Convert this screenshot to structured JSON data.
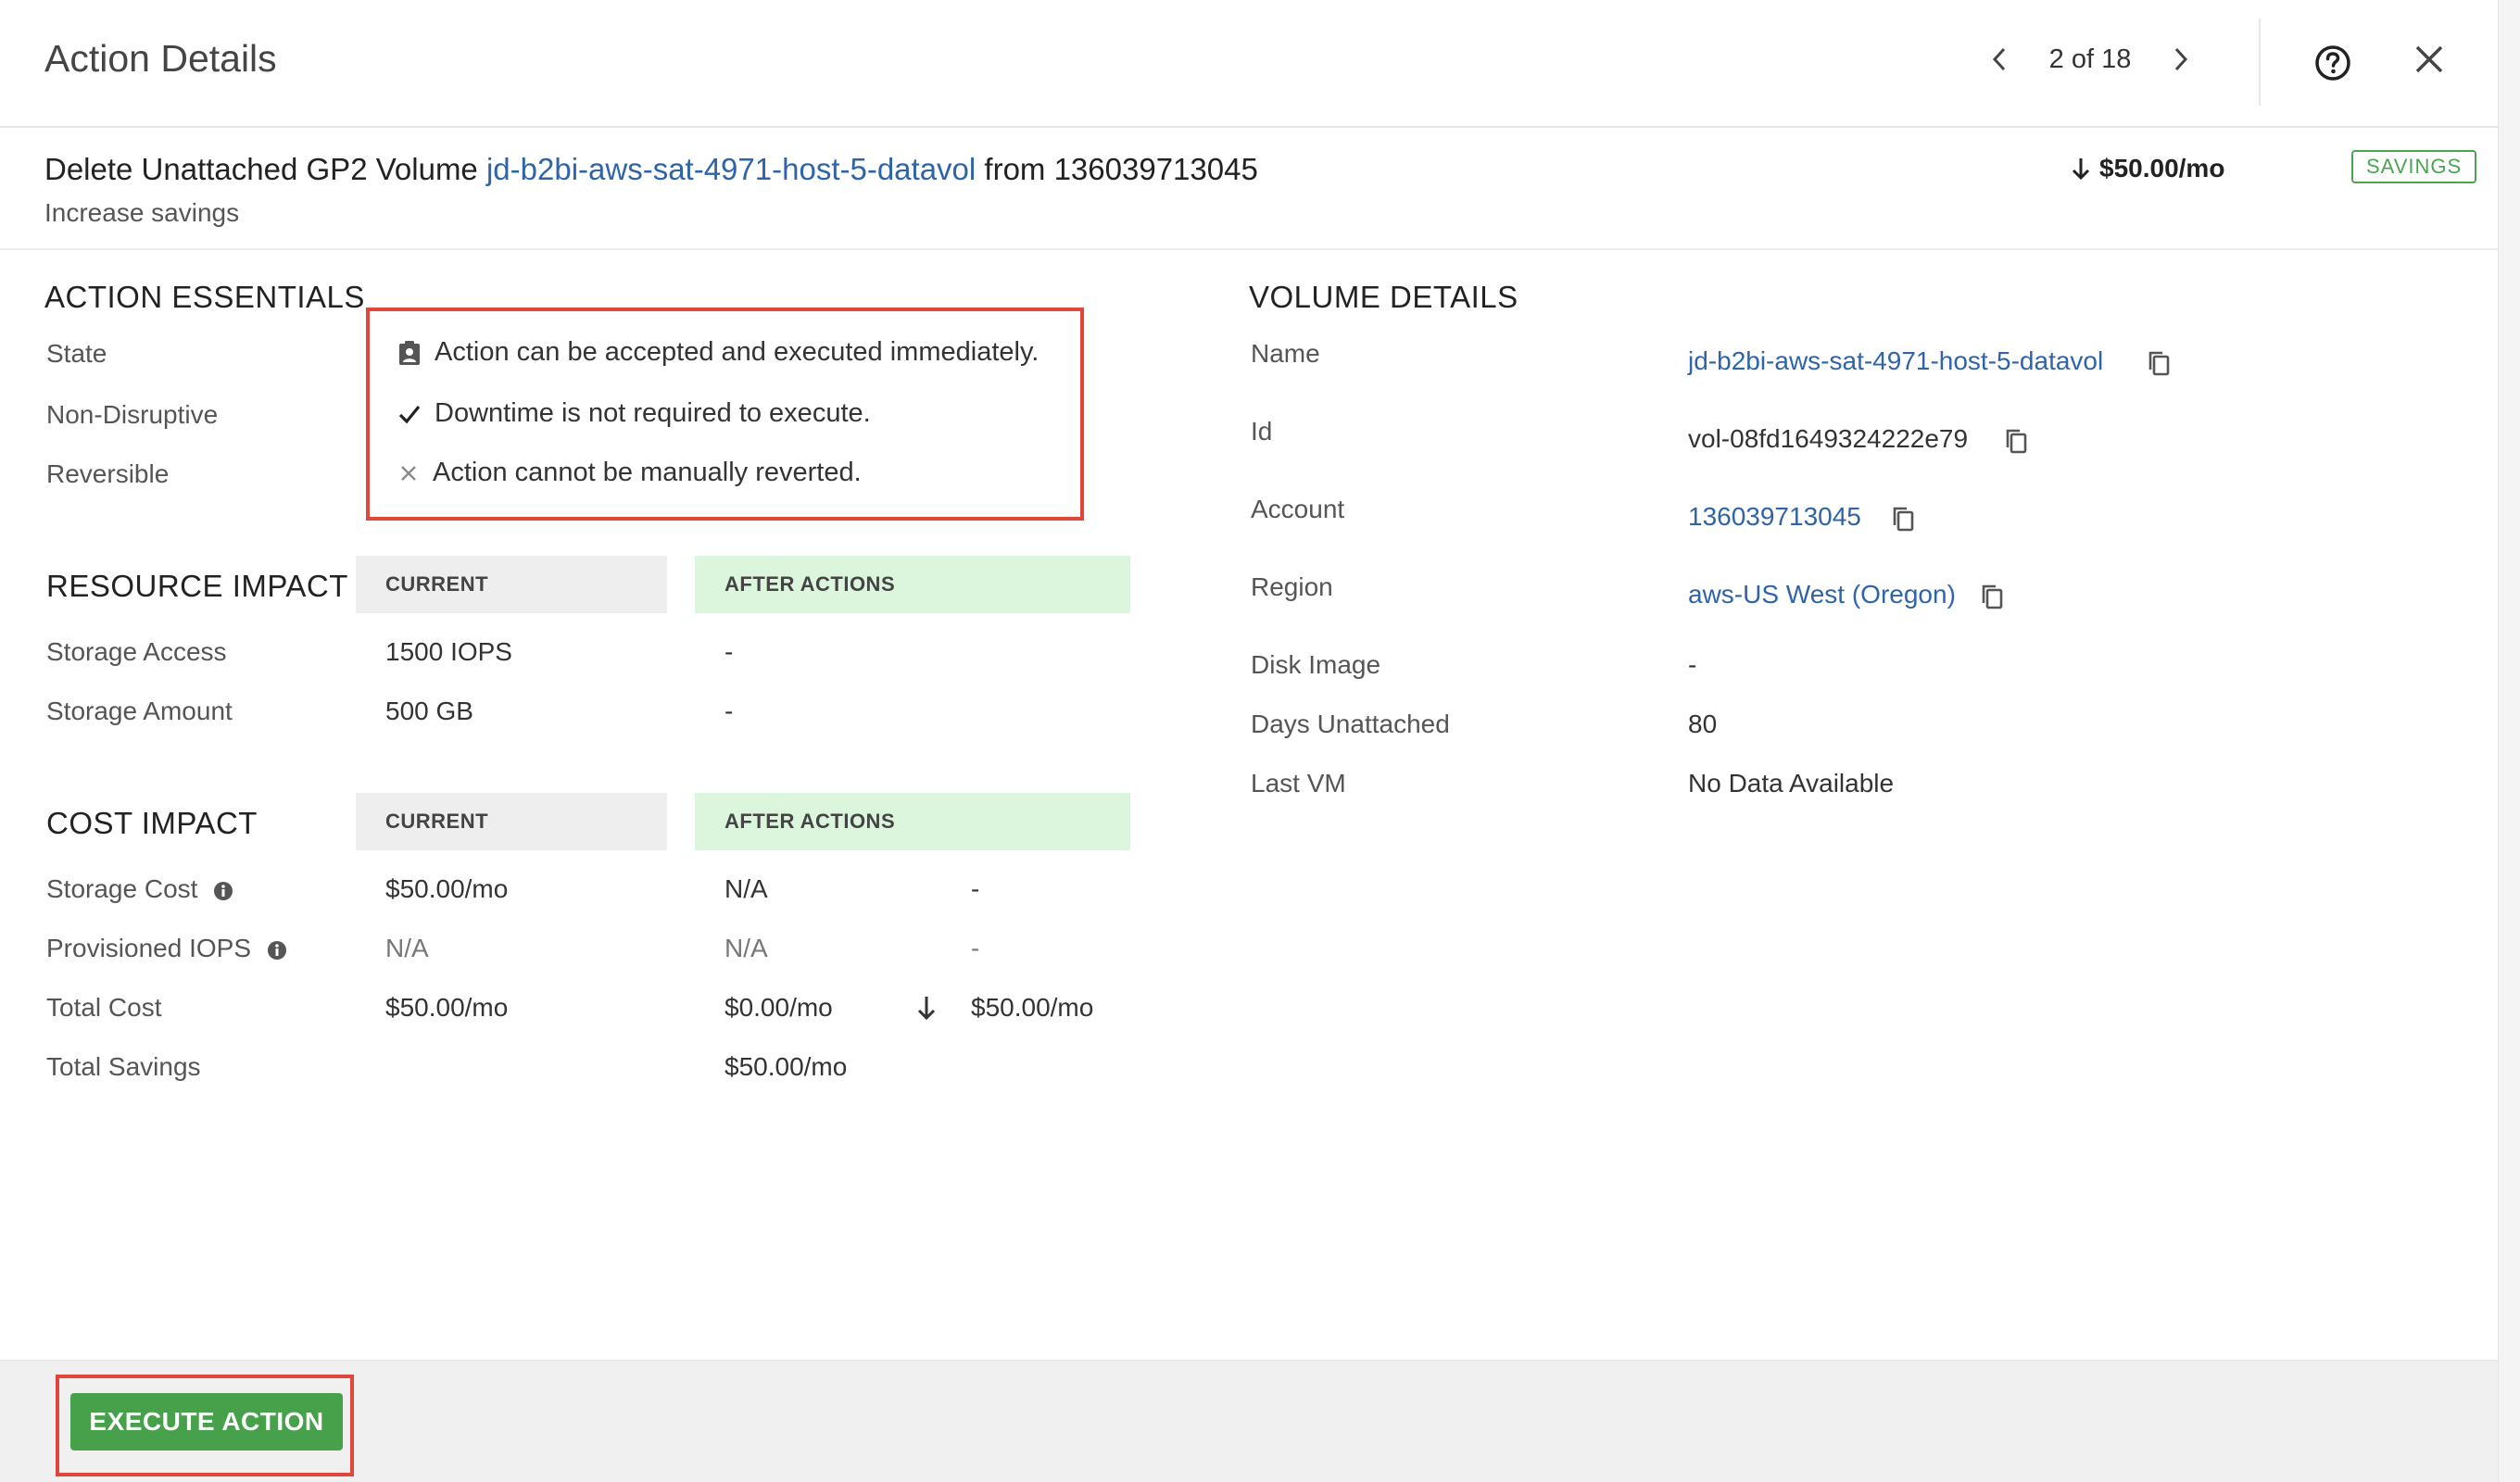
{
  "header": {
    "title": "Action Details",
    "pager": {
      "text": "2 of 18"
    }
  },
  "summary": {
    "prefix": "Delete Unattached GP2 Volume",
    "volume_link": "jd-b2bi-aws-sat-4971-host-5-datavol",
    "middle": "from",
    "account": "136039713045",
    "subtitle": "Increase savings",
    "savings_amount": "$50.00/mo",
    "badge": "SAVINGS"
  },
  "action_essentials": {
    "title": "ACTION ESSENTIALS",
    "rows": [
      {
        "label": "State",
        "text": "Action can be accepted and executed immediately.",
        "icon": "clipboard-person-icon"
      },
      {
        "label": "Non-Disruptive",
        "text": "Downtime is not required to execute.",
        "icon": "check-icon"
      },
      {
        "label": "Reversible",
        "text": "Action cannot be manually reverted.",
        "icon": "x-icon"
      }
    ]
  },
  "resource_impact": {
    "title": "RESOURCE IMPACT",
    "col_current": "CURRENT",
    "col_after": "AFTER ACTIONS",
    "rows": [
      {
        "label": "Storage Access",
        "current": "1500 IOPS",
        "after": "-"
      },
      {
        "label": "Storage Amount",
        "current": "500 GB",
        "after": "-"
      }
    ]
  },
  "cost_impact": {
    "title": "COST IMPACT",
    "col_current": "CURRENT",
    "col_after": "AFTER ACTIONS",
    "rows": [
      {
        "label": "Storage Cost",
        "current": "$50.00/mo",
        "after": "N/A",
        "delta": "-"
      },
      {
        "label": "Provisioned IOPS",
        "current": "N/A",
        "after": "N/A",
        "delta": "-"
      },
      {
        "label": "Total Cost",
        "current": "$50.00/mo",
        "after": "$0.00/mo",
        "delta": "$50.00/mo"
      },
      {
        "label": "Total Savings",
        "current": "",
        "after": "$50.00/mo",
        "delta": ""
      }
    ]
  },
  "volume_details": {
    "title": "VOLUME DETAILS",
    "rows": [
      {
        "label": "Name",
        "value": "jd-b2bi-aws-sat-4971-host-5-datavol"
      },
      {
        "label": "Id",
        "value": "vol-08fd1649324222e79"
      },
      {
        "label": "Account",
        "value": "136039713045"
      },
      {
        "label": "Region",
        "value": "aws-US West (Oregon)"
      },
      {
        "label": "Disk Image",
        "value": "-"
      },
      {
        "label": "Days Unattached",
        "value": "80"
      },
      {
        "label": "Last VM",
        "value": "No Data Available"
      }
    ]
  },
  "footer": {
    "execute_label": "EXECUTE ACTION"
  },
  "colors": {
    "link": "#2f64a8",
    "savings_green": "#4aa552",
    "button_green": "#47a04a",
    "highlight_red": "#e0463a",
    "after_header_bg": "#dcf5dd"
  }
}
